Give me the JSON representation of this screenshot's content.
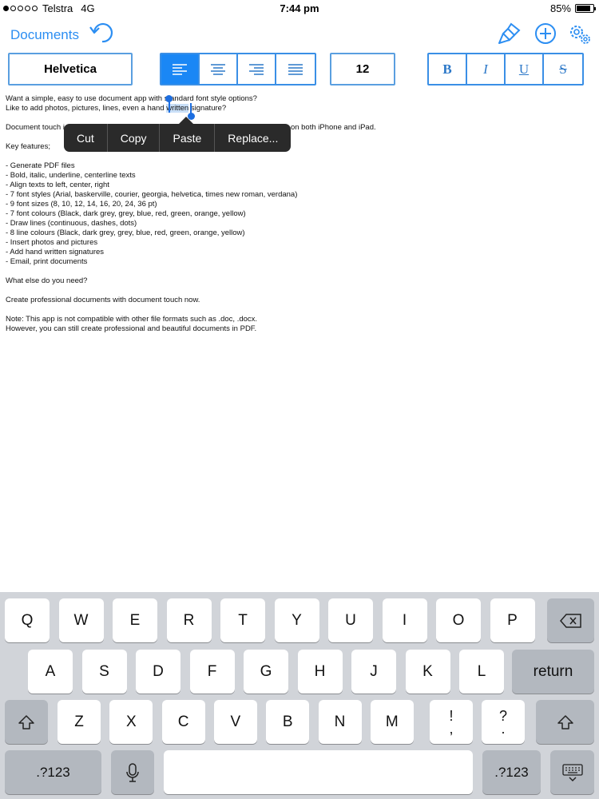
{
  "status_bar": {
    "carrier": "Telstra",
    "network": "4G",
    "time": "7:44 pm",
    "battery": "85%",
    "signal_bars_filled": 1,
    "signal_bars_total": 5,
    "battery_level": 0.85
  },
  "nav": {
    "back_label": "Documents",
    "icons": [
      "undo-icon",
      "brush-icon",
      "add-icon",
      "settings-icon"
    ]
  },
  "toolbar": {
    "font_name": "Helvetica",
    "font_size": "12",
    "alignment_selected": "left",
    "bold_label": "B",
    "italic_label": "I",
    "underline_label": "U",
    "strike_label": "S"
  },
  "document": {
    "line1_before": "Want a simple, easy to use document app with ",
    "line1_after": "standard font style options?",
    "line2_before": "Like to add photos, pictures, lines, even a hand ",
    "line2_selected": "written",
    "line2_after": " signature?",
    "line3_start": "Document touch i",
    "line3_end": "on both iPhone and iPad.",
    "lines": [
      "Key features;",
      "",
      "- Generate PDF files",
      "- Bold, italic, underline, centerline texts",
      "- Align texts to left, center, right",
      "- 7 font styles (Arial, baskerville, courier, georgia, helvetica, times new roman, verdana)",
      "- 9 font sizes (8, 10, 12, 14, 16, 20, 24, 36 pt)",
      "- 7 font colours (Black, dark grey, grey, blue, red, green, orange, yellow)",
      "- Draw lines (continuous, dashes, dots)",
      "- 8 line colours (Black, dark grey, grey, blue, red, green, orange, yellow)",
      "- Insert photos and pictures",
      "- Add hand written signatures",
      "- Email, print documents",
      "",
      "What else do you need?",
      "",
      "Create professional documents with document touch now.",
      "",
      "Note: This app is not compatible with other file formats such as .doc, .docx.",
      "However, you can still create professional and beautiful documents in PDF."
    ]
  },
  "edit_menu": {
    "items": [
      "Cut",
      "Copy",
      "Paste",
      "Replace..."
    ]
  },
  "keyboard": {
    "row1": [
      "Q",
      "W",
      "E",
      "R",
      "T",
      "Y",
      "U",
      "I",
      "O",
      "P"
    ],
    "row2": [
      "A",
      "S",
      "D",
      "F",
      "G",
      "H",
      "J",
      "K",
      "L"
    ],
    "row3": [
      "Z",
      "X",
      "C",
      "V",
      "B",
      "N",
      "M"
    ],
    "return_label": "return",
    "exclaim_top": "!",
    "exclaim_bottom": ",",
    "question_top": "?",
    "question_bottom": ".",
    "numbers_label": ".?123",
    "icons": [
      "backspace-icon",
      "shift-icon",
      "microphone-icon",
      "keyboard-hide-icon"
    ]
  },
  "colors": {
    "accent": "#2c8ef2",
    "keyboard_bg": "#d1d4d9",
    "function_key": "#b3b8bf"
  }
}
